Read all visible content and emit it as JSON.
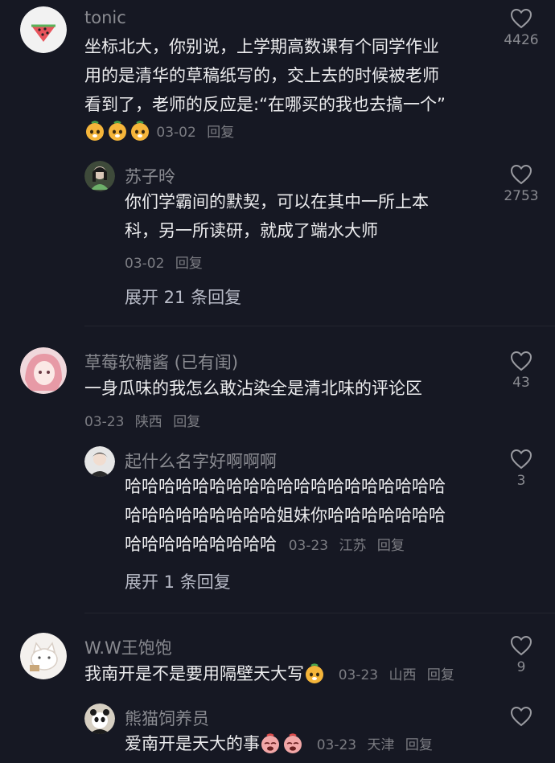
{
  "comments": [
    {
      "name": "tonic",
      "text_lines": [
        "坐标北大，你别说，上学期高数课有个同学作业",
        "用的是清华的草稿纸写的，交上去的时候被老师",
        "看到了，老师的反应是:“在哪买的我也去搞一个”"
      ],
      "date": "03-02",
      "reply": "回复",
      "likes": "4426",
      "sub": {
        "name": "苏子昤",
        "text_lines": [
          "你们学霸间的默契，可以在其中一所上本",
          "科，另一所读研，就成了端水大师"
        ],
        "date": "03-02",
        "reply": "回复",
        "likes": "2753"
      },
      "expand": "展开 21 条回复"
    },
    {
      "name": "草莓软糖酱 (已有闺)",
      "text_lines": [
        "一身瓜味的我怎么敢沾染全是清北味的评论区"
      ],
      "date": "03-23",
      "location": "陕西",
      "reply": "回复",
      "likes": "43",
      "sub": {
        "name": "起什么名字好啊啊啊",
        "text_lines": [
          "哈哈哈哈哈哈哈哈哈哈哈哈哈哈哈哈哈哈哈",
          "哈哈哈哈哈哈哈哈哈姐妹你哈哈哈哈哈哈哈",
          "哈哈哈哈哈哈哈哈哈"
        ],
        "date": "03-23",
        "location": "江苏",
        "reply": "回复",
        "likes": "3"
      },
      "expand": "展开 1 条回复"
    },
    {
      "name": "W.W王饱饱",
      "text_lines": [
        "我南开是不是要用隔壁天大写"
      ],
      "date": "03-23",
      "location": "山西",
      "reply": "回复",
      "likes": "9",
      "sub": {
        "name": "熊猫饲养员",
        "text_lines": [
          "爱南开是天大的事"
        ],
        "date": "03-23",
        "location": "天津",
        "reply": "回复",
        "likes": ""
      }
    }
  ],
  "icons": {
    "like": "heart-outline-icon",
    "emoji_face": "orange-face-emoji-icon",
    "emoji_cry": "crying-face-emoji-icon"
  },
  "colors": {
    "background": "#161823",
    "text": "#ececee",
    "secondary": "#8a8b91"
  }
}
